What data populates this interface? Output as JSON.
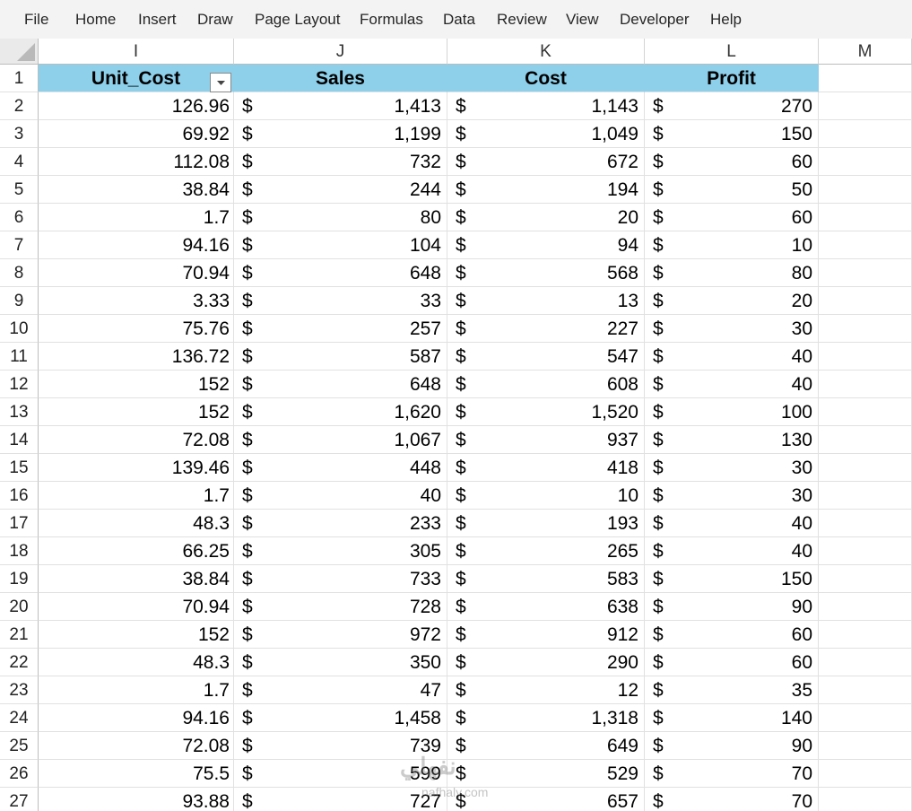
{
  "ribbon": {
    "tabs": [
      "File",
      "Home",
      "Insert",
      "Draw",
      "Page Layout",
      "Formulas",
      "Data",
      "Review",
      "View",
      "Developer",
      "Help"
    ]
  },
  "columns": [
    "I",
    "J",
    "K",
    "L",
    "M"
  ],
  "table": {
    "headers": [
      "Unit_Cost",
      "Sales",
      "Cost",
      "Profit"
    ],
    "currency_symbol": "$",
    "rows": [
      [
        "126.96",
        "1,413",
        "1,143",
        "270"
      ],
      [
        "69.92",
        "1,199",
        "1,049",
        "150"
      ],
      [
        "112.08",
        "732",
        "672",
        "60"
      ],
      [
        "38.84",
        "244",
        "194",
        "50"
      ],
      [
        "1.7",
        "80",
        "20",
        "60"
      ],
      [
        "94.16",
        "104",
        "94",
        "10"
      ],
      [
        "70.94",
        "648",
        "568",
        "80"
      ],
      [
        "3.33",
        "33",
        "13",
        "20"
      ],
      [
        "75.76",
        "257",
        "227",
        "30"
      ],
      [
        "136.72",
        "587",
        "547",
        "40"
      ],
      [
        "152",
        "648",
        "608",
        "40"
      ],
      [
        "152",
        "1,620",
        "1,520",
        "100"
      ],
      [
        "72.08",
        "1,067",
        "937",
        "130"
      ],
      [
        "139.46",
        "448",
        "418",
        "30"
      ],
      [
        "1.7",
        "40",
        "10",
        "30"
      ],
      [
        "48.3",
        "233",
        "193",
        "40"
      ],
      [
        "66.25",
        "305",
        "265",
        "40"
      ],
      [
        "38.84",
        "733",
        "583",
        "150"
      ],
      [
        "70.94",
        "728",
        "638",
        "90"
      ],
      [
        "152",
        "972",
        "912",
        "60"
      ],
      [
        "48.3",
        "350",
        "290",
        "60"
      ],
      [
        "1.7",
        "47",
        "12",
        "35"
      ],
      [
        "94.16",
        "1,458",
        "1,318",
        "140"
      ],
      [
        "72.08",
        "739",
        "649",
        "90"
      ],
      [
        "75.5",
        "599",
        "529",
        "70"
      ],
      [
        "93.88",
        "727",
        "657",
        "70"
      ]
    ]
  },
  "colors": {
    "header_fill": "#8ecfea",
    "ribbon_bg": "#f3f3f3",
    "gridline": "#e1e1e1"
  },
  "icons": {
    "filter": "filter-dropdown-icon",
    "select_all": "select-all-triangle-icon"
  },
  "watermark": {
    "text": "نفهلي",
    "sub": "nafhaly.com"
  }
}
